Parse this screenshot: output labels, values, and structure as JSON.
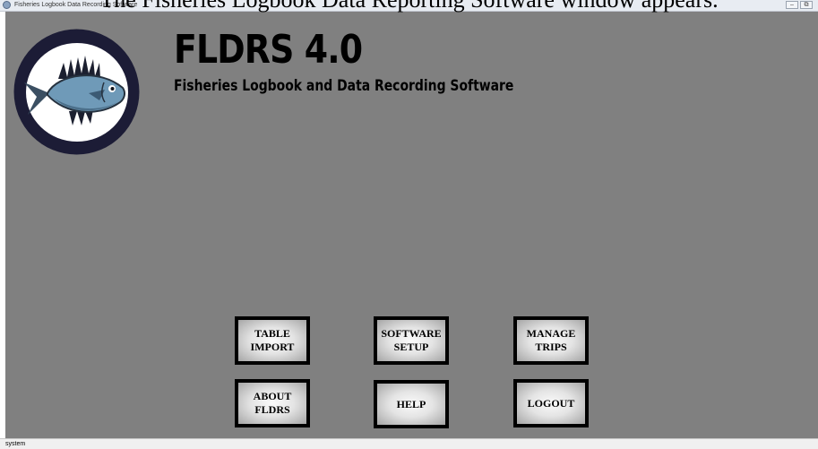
{
  "caption": "The Fisheries Logbook Data Reporting Software window appears.",
  "window": {
    "title": "Fisheries Logbook Data Recording Software",
    "minimize_glyph": "–",
    "restore_glyph": "⧉"
  },
  "header": {
    "app_name": "FLDRS 4.0",
    "subtitle": "Fisheries Logbook and Data Recording Software",
    "logo_icon": "fish-icon"
  },
  "buttons": {
    "table_import": "TABLE\nIMPORT",
    "software_setup": "SOFTWARE\nSETUP",
    "manage_trips": "MANAGE\nTRIPS",
    "about_fldrs": "ABOUT\nFLDRS",
    "help": "HELP",
    "logout": "LOGOUT"
  },
  "status": {
    "user": "system"
  },
  "colors": {
    "background": "#808080",
    "logo_ring": "#1c1c36",
    "fish": "#6f9ab8",
    "button_border": "#000000"
  }
}
